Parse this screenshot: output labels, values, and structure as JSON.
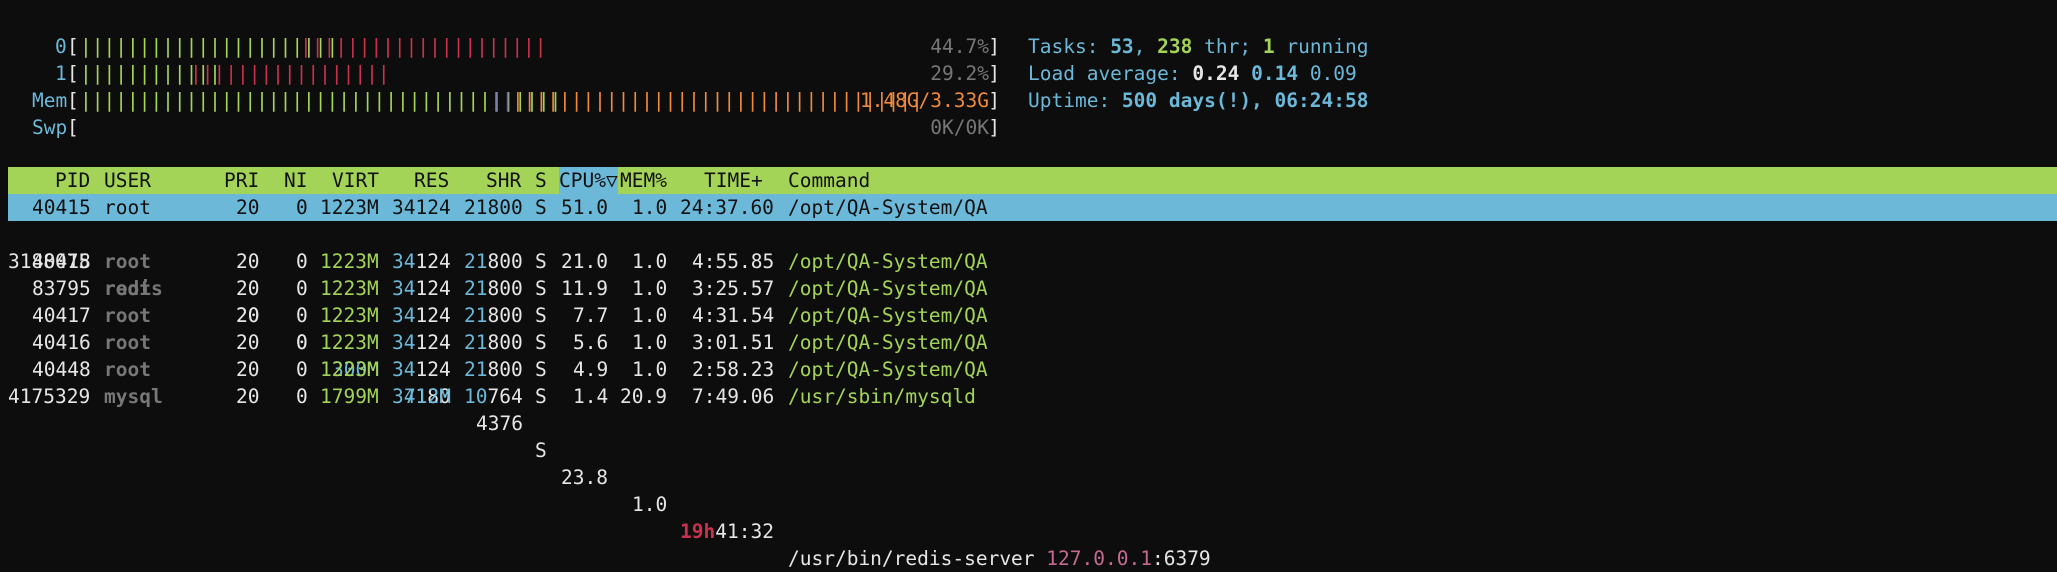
{
  "meters": [
    {
      "label": "0",
      "value": "44.7%",
      "green_bars": 22,
      "red_bars": 21
    },
    {
      "label": "1",
      "value": "29.2%",
      "green_bars": 12,
      "red_bars": 17
    },
    {
      "label": "Mem",
      "value": "1.48G/3.33G",
      "green_bars": 41,
      "purple_bars": 2,
      "orange_bars": 35
    },
    {
      "label": "Swp",
      "value": "0K/0K"
    }
  ],
  "summary": {
    "tasks_label": "Tasks: ",
    "tasks": "53",
    "sep1": ", ",
    "threads": "238",
    "thr_label": " thr; ",
    "running": "1",
    "running_label": " running",
    "load_label": "Load average: ",
    "load1": "0.24",
    "load5": "0.14",
    "load15": "0.09",
    "uptime_label": "Uptime: ",
    "uptime": "500 days(!), 06:24:58"
  },
  "columns": {
    "pid": "PID",
    "user": "USER",
    "pri": "PRI",
    "ni": "NI",
    "virt": "VIRT",
    "res": "RES",
    "shr": "SHR",
    "s": "S",
    "cpu": "CPU%▽",
    "mem": "MEM%",
    "time": "TIME+",
    "command": "Command"
  },
  "processes": [
    {
      "pid": "40415",
      "user": "root",
      "pri": "20",
      "ni": "0",
      "virt": "1223M",
      "res": "34124",
      "shr": "21800",
      "s": "S",
      "cpu": "51.0",
      "mem": "1.0",
      "time": "24:37.60",
      "command": "/opt/QA-System/QA"
    },
    {
      "pid": "3188075",
      "user": "redis",
      "pri": "20",
      "ni": "0",
      "virt": "300M",
      "res_hi": "34",
      "res_lo": "180",
      "shr": "4376",
      "s": "S",
      "cpu": "23.8",
      "mem": "1.0",
      "time_hi": "19h",
      "time_lo": "41:32",
      "command": "/usr/bin/redis-server",
      "cmd_arg_ip": "127.0.0.1",
      "cmd_arg_port": ":6379"
    },
    {
      "pid": "40418",
      "user": "root",
      "pri": "20",
      "ni": "0",
      "virt": "1223M",
      "res_hi": "34",
      "res_lo": "124",
      "shr_hi": "21",
      "shr_lo": "800",
      "s": "S",
      "cpu": "21.0",
      "mem": "1.0",
      "time": "4:55.85",
      "command": "/opt/QA-System/QA"
    },
    {
      "pid": "83795",
      "user": "root",
      "pri": "20",
      "ni": "0",
      "virt": "1223M",
      "res_hi": "34",
      "res_lo": "124",
      "shr_hi": "21",
      "shr_lo": "800",
      "s": "S",
      "cpu": "11.9",
      "mem": "1.0",
      "time": "3:25.57",
      "command": "/opt/QA-System/QA"
    },
    {
      "pid": "40417",
      "user": "root",
      "pri": "20",
      "ni": "0",
      "virt": "1223M",
      "res_hi": "34",
      "res_lo": "124",
      "shr_hi": "21",
      "shr_lo": "800",
      "s": "S",
      "cpu": "7.7",
      "mem": "1.0",
      "time": "4:31.54",
      "command": "/opt/QA-System/QA"
    },
    {
      "pid": "40416",
      "user": "root",
      "pri": "20",
      "ni": "0",
      "virt": "1223M",
      "res_hi": "34",
      "res_lo": "124",
      "shr_hi": "21",
      "shr_lo": "800",
      "s": "S",
      "cpu": "5.6",
      "mem": "1.0",
      "time": "3:01.51",
      "command": "/opt/QA-System/QA"
    },
    {
      "pid": "40448",
      "user": "root",
      "pri": "20",
      "ni": "0",
      "virt": "1223M",
      "res_hi": "34",
      "res_lo": "124",
      "shr_hi": "21",
      "shr_lo": "800",
      "s": "S",
      "cpu": "4.9",
      "mem": "1.0",
      "time": "2:58.23",
      "command": "/opt/QA-System/QA"
    },
    {
      "pid": "4175329",
      "user": "mysql",
      "pri": "20",
      "ni": "0",
      "virt": "1799M",
      "res": "712M",
      "shr_hi": "10",
      "shr_lo": "764",
      "s": "S",
      "cpu": "1.4",
      "mem": "20.9",
      "time": "7:49.06",
      "command": "/usr/sbin/mysqld"
    }
  ],
  "colors": {
    "header_bg": "#a4d457",
    "selected_bg": "#6cb8d8",
    "green": "#a4d457",
    "cyan": "#6cb8d8",
    "red": "#c8324e",
    "orange": "#f08a3c"
  }
}
